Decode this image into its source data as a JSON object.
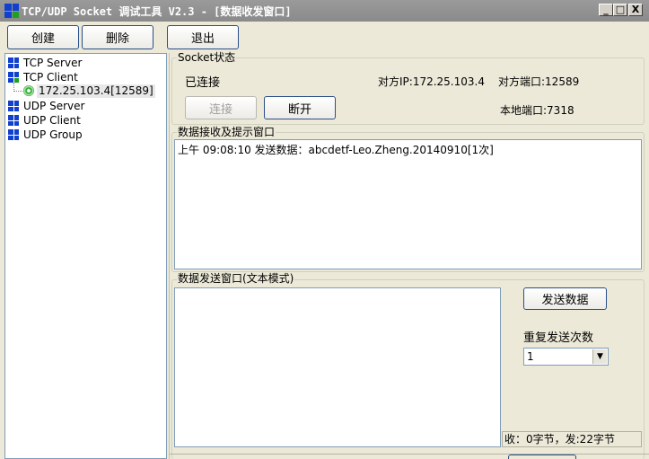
{
  "window": {
    "title": "TCP/UDP Socket 调试工具 V2.3 - [数据收发窗口]",
    "caption_buttons": [
      "_",
      "□",
      "X"
    ]
  },
  "toolbar": {
    "create_label": "创建",
    "delete_label": "删除",
    "exit_label": "退出"
  },
  "tree": {
    "items": [
      {
        "label": "TCP Server"
      },
      {
        "label": "TCP Client"
      },
      {
        "label": "172.25.103.4[12589]"
      },
      {
        "label": "UDP Server"
      },
      {
        "label": "UDP Client"
      },
      {
        "label": "UDP Group"
      }
    ]
  },
  "socket_status": {
    "group_label": "Socket状态",
    "status": "已连接",
    "remote_ip": "对方IP:172.25.103.4",
    "remote_port": "对方端口:12589",
    "local_port": "本地端口:7318",
    "connect_label": "连接",
    "disconnect_label": "断开"
  },
  "receive": {
    "group_label": "数据接收及提示窗口",
    "lines": [
      "上午 09:08:10 发送数据：abcdetf-Leo.Zheng.20140910[1次]"
    ]
  },
  "send": {
    "group_label": "数据发送窗口(文本模式)",
    "send_button_label": "发送数据",
    "repeat_label": "重复发送次数",
    "repeat_value": "1",
    "stats": "收：0字节，发:22字节"
  },
  "colors": {
    "titlebar": "#8a8a8a",
    "icon_blue": "#0000ff",
    "icon_green": "#008000",
    "selected_bg": "#e8e8e8"
  }
}
